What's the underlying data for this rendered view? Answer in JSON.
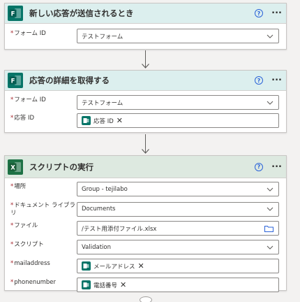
{
  "trigger": {
    "title": "新しい応答が送信されるとき",
    "help": "?",
    "more": "···",
    "fields": [
      {
        "label": "フォーム ID",
        "value": "テストフォーム"
      }
    ]
  },
  "details": {
    "title": "応答の詳細を取得する",
    "help": "?",
    "more": "···",
    "fields": [
      {
        "label": "フォーム ID",
        "value": "テストフォーム"
      },
      {
        "label": "応答 ID",
        "token": "応答 ID"
      }
    ]
  },
  "script": {
    "title": "スクリプトの実行",
    "help": "?",
    "more": "···",
    "fields": [
      {
        "label": "場所",
        "value": "Group - tejilabo"
      },
      {
        "label": "ドキュメント ライブラリ",
        "value": "Documents"
      },
      {
        "label": "ファイル",
        "value": "/テスト用添付ファイル.xlsx"
      },
      {
        "label": "スクリプト",
        "value": "Validation"
      },
      {
        "label": "mailaddress",
        "token": "メールアドレス"
      },
      {
        "label": "phonenumber",
        "token": "電話番号"
      }
    ]
  },
  "colors": {
    "forms_accent": "#077568",
    "excel_accent": "#1e7145",
    "help_blue": "#2b63d8",
    "required_red": "#a4262c"
  },
  "icons": {
    "forms": "microsoft-forms-icon",
    "excel": "microsoft-excel-icon",
    "help": "help-icon",
    "more": "more-options-icon",
    "dropdown": "chevron-down-icon",
    "folder": "folder-icon",
    "remove": "close-icon"
  }
}
